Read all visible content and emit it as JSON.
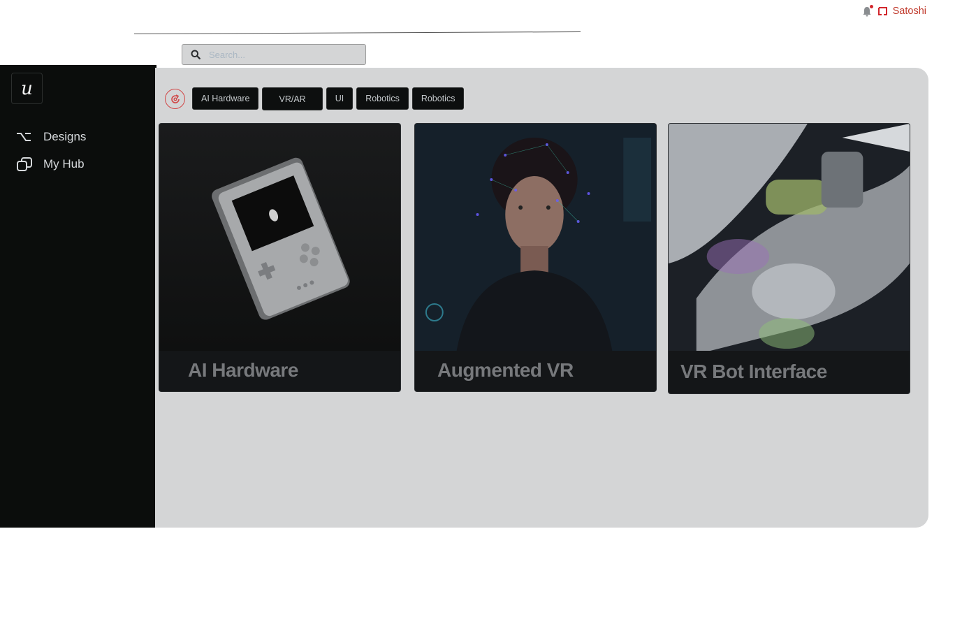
{
  "header": {
    "username": "Satoshi",
    "notification_dot_color": "#d2262c",
    "icons": [
      "bell-icon",
      "user-mark-icon"
    ]
  },
  "search": {
    "placeholder": "Search..."
  },
  "sidebar": {
    "logo": "u",
    "items": [
      {
        "label": "Designs",
        "icon": "option-key-icon"
      },
      {
        "label": "My Hub",
        "icon": "stack-icon"
      }
    ]
  },
  "filters": {
    "refresh_icon": "refresh-icon",
    "chips": [
      "AI Hardware",
      "VR/AR",
      "UI",
      "Robotics",
      "Robotics"
    ]
  },
  "cards": [
    {
      "title": "AI Hardware",
      "image": "handheld-console-image"
    },
    {
      "title": "Augmented VR",
      "image": "holographic-portrait-image"
    },
    {
      "title": "VR Bot Interface",
      "image": "robot-arm-image"
    }
  ],
  "colors": {
    "sidebar_bg": "#0b0d0c",
    "panel_bg": "#d4d5d6",
    "accent": "#d14848"
  }
}
